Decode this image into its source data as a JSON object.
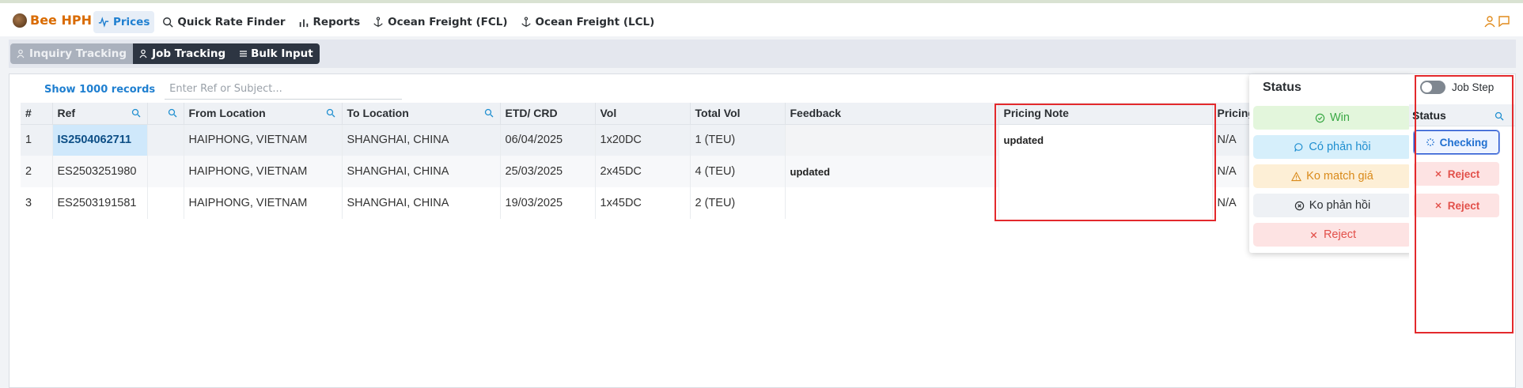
{
  "brand": {
    "name": "Bee HPH"
  },
  "nav": {
    "items": [
      {
        "label": "Prices",
        "icon": "pulse-icon"
      },
      {
        "label": "Quick Rate Finder",
        "icon": "search-icon"
      },
      {
        "label": "Reports",
        "icon": "bar-chart-icon"
      },
      {
        "label": "Ocean Freight (FCL)",
        "icon": "anchor-icon"
      },
      {
        "label": "Ocean Freight (LCL)",
        "icon": "anchor-icon"
      }
    ]
  },
  "subtabs": [
    {
      "label": "Inquiry Tracking"
    },
    {
      "label": "Job Tracking"
    },
    {
      "label": "Bulk Input"
    }
  ],
  "search": {
    "show_label": "Show 1000 records",
    "placeholder": "Enter Ref or Subject..."
  },
  "table": {
    "headers": [
      "#",
      "Ref",
      "",
      "From Location",
      "To Location",
      "ETD/ CRD",
      "Vol",
      "Total Vol",
      "Feedback",
      "Pricing Note",
      "Pricing"
    ],
    "rows": [
      {
        "num": "1",
        "ref": "IS2504062711",
        "from": "HAIPHONG, VIETNAM",
        "to": "SHANGHAI, CHINA",
        "etd": "06/04/2025",
        "vol": "1x20DC",
        "total": "1 (TEU)",
        "feedback": "",
        "note": "updated",
        "pricing": "N/A"
      },
      {
        "num": "2",
        "ref": "ES2503251980",
        "from": "HAIPHONG, VIETNAM",
        "to": "SHANGHAI, CHINA",
        "etd": "25/03/2025",
        "vol": "2x45DC",
        "total": "4 (TEU)",
        "feedback": "updated",
        "note": "",
        "pricing": "N/A"
      },
      {
        "num": "3",
        "ref": "ES2503191581",
        "from": "HAIPHONG, VIETNAM",
        "to": "SHANGHAI, CHINA",
        "etd": "19/03/2025",
        "vol": "1x45DC",
        "total": "2 (TEU)",
        "feedback": "",
        "note": "",
        "pricing": "N/A"
      }
    ]
  },
  "status_popup": {
    "title": "Status",
    "options": [
      {
        "label": "Win",
        "color": "#3aa845",
        "bg": "#e3f6dc"
      },
      {
        "label": "Có phản hồi",
        "color": "#1f8fd0",
        "bg": "#d6effb"
      },
      {
        "label": "Ko match giá",
        "color": "#d98a1a",
        "bg": "#fdefd6"
      },
      {
        "label": "Ko phản hồi",
        "color": "#2b2f33",
        "bg": "#eef1f5"
      },
      {
        "label": "Reject",
        "color": "#e2504a",
        "bg": "#fde3e3"
      }
    ]
  },
  "right_panel": {
    "toggle_label": "Job Step",
    "header": "Status",
    "rows": [
      "Checking",
      "Reject",
      "Reject"
    ]
  }
}
